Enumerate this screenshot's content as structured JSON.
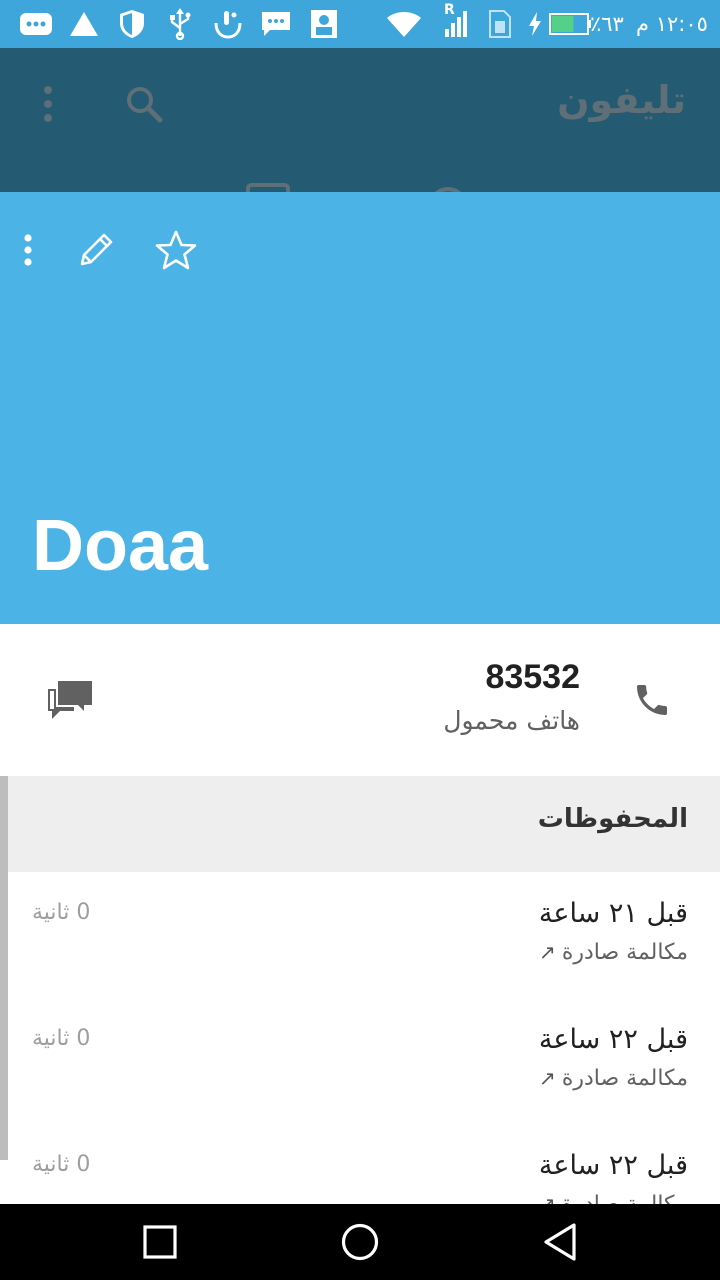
{
  "status_bar": {
    "time": "١٢:٠٥ م",
    "battery_percent": "٦٣٪",
    "battery_level": 0.63,
    "network_label": "R",
    "colors": {
      "background": "#3fa6dc"
    },
    "icons": [
      "more-notifications-icon",
      "warning-icon",
      "shield-icon",
      "usb-icon",
      "touchpal-icon",
      "message-icon",
      "contact-card-icon",
      "wifi-icon",
      "signal-icon",
      "sim-icon",
      "charging-icon",
      "battery-icon"
    ]
  },
  "app_bar": {
    "title": "تليفون",
    "icons": [
      "search-icon",
      "more-vert-icon"
    ],
    "colors": {
      "background": "#245a72"
    }
  },
  "contact": {
    "name": "Doaa",
    "header_icons": [
      "more-vert-icon",
      "edit-icon",
      "star-outline-icon"
    ],
    "colors": {
      "header": "#4bb3e6"
    },
    "phone": {
      "number": "83532",
      "type": "هاتف محمول"
    }
  },
  "history": {
    "title": "المحفوظات",
    "items": [
      {
        "time": "قبل ٢١ ساعة",
        "type": "مكالمة صادرة",
        "arrow": "↗",
        "duration": "0 ثانية"
      },
      {
        "time": "قبل ٢٢ ساعة",
        "type": "مكالمة صادرة",
        "arrow": "↗",
        "duration": "0 ثانية"
      },
      {
        "time": "قبل ٢٢ ساعة",
        "type": "مكالمة صادرة",
        "arrow": "↗",
        "duration": "0 ثانية"
      }
    ]
  },
  "nav_bar": {
    "icons": [
      "recents-icon",
      "home-icon",
      "back-icon"
    ]
  }
}
